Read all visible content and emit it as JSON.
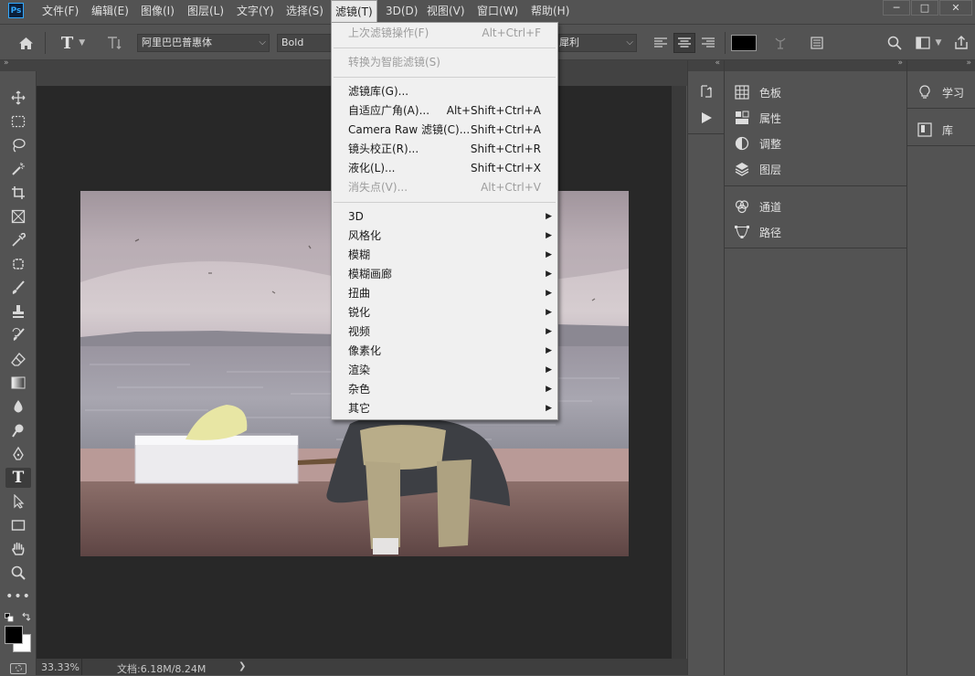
{
  "app": {
    "logo": "Ps"
  },
  "menubar": {
    "items": [
      {
        "label": "文件(F)"
      },
      {
        "label": "编辑(E)"
      },
      {
        "label": "图像(I)"
      },
      {
        "label": "图层(L)"
      },
      {
        "label": "文字(Y)"
      },
      {
        "label": "选择(S)"
      },
      {
        "label": "滤镜(T)"
      },
      {
        "label": "3D(D)"
      },
      {
        "label": "视图(V)"
      },
      {
        "label": "窗口(W)"
      },
      {
        "label": "帮助(H)"
      }
    ],
    "window_controls": [
      "─",
      "□",
      "✕"
    ]
  },
  "options": {
    "font_family": "阿里巴巴普惠体",
    "font_style": "Bold",
    "antialias": "犀利",
    "text_color": "#000000"
  },
  "filter_menu": {
    "items": [
      {
        "label": "上次滤镜操作(F)",
        "shortcut": "Alt+Ctrl+F",
        "disabled": true
      },
      {
        "label": "转换为智能滤镜(S)",
        "disabled": true
      },
      {
        "label": "滤镜库(G)..."
      },
      {
        "label": "自适应广角(A)...",
        "shortcut": "Alt+Shift+Ctrl+A"
      },
      {
        "label": "Camera Raw 滤镜(C)...",
        "shortcut": "Shift+Ctrl+A"
      },
      {
        "label": "镜头校正(R)...",
        "shortcut": "Shift+Ctrl+R"
      },
      {
        "label": "液化(L)...",
        "shortcut": "Shift+Ctrl+X"
      },
      {
        "label": "消失点(V)...",
        "shortcut": "Alt+Ctrl+V",
        "disabled": true
      },
      {
        "label": "3D",
        "submenu": true
      },
      {
        "label": "风格化",
        "submenu": true
      },
      {
        "label": "模糊",
        "submenu": true
      },
      {
        "label": "模糊画廊",
        "submenu": true
      },
      {
        "label": "扭曲",
        "submenu": true
      },
      {
        "label": "锐化",
        "submenu": true
      },
      {
        "label": "视频",
        "submenu": true
      },
      {
        "label": "像素化",
        "submenu": true
      },
      {
        "label": "渲染",
        "submenu": true
      },
      {
        "label": "杂色",
        "submenu": true
      },
      {
        "label": "其它",
        "submenu": true
      }
    ]
  },
  "panels": {
    "group1": [
      {
        "label": "色板",
        "icon": "swatches-icon"
      },
      {
        "label": "属性",
        "icon": "properties-icon"
      },
      {
        "label": "调整",
        "icon": "adjustments-icon"
      },
      {
        "label": "图层",
        "icon": "layers-icon"
      }
    ],
    "group2": [
      {
        "label": "通道",
        "icon": "channels-icon"
      },
      {
        "label": "路径",
        "icon": "paths-icon"
      }
    ],
    "right": [
      {
        "label": "学习",
        "icon": "learn-icon"
      },
      {
        "label": "库",
        "icon": "libraries-icon"
      }
    ]
  },
  "status": {
    "zoom": "33.33%",
    "doc": "文档:6.18M/8.24M",
    "arrow": "❯"
  }
}
